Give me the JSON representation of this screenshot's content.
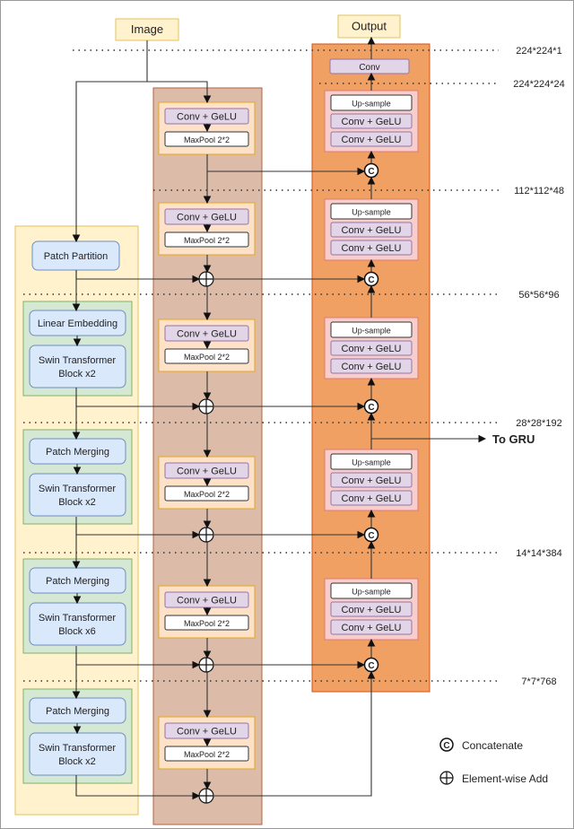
{
  "title_input": "Image",
  "title_output": "Output",
  "encoder": {
    "conv": "Conv + GeLU",
    "pool": "MaxPool 2*2"
  },
  "decoder": {
    "up": "Up-sample",
    "conv": "Conv + GeLU",
    "final_conv": "Conv"
  },
  "swin": {
    "partition": "Patch Partition",
    "embedding": "Linear Embedding",
    "merging": "Patch Merging",
    "blocks": [
      [
        "Swin Transformer",
        "Block x2"
      ],
      [
        "Swin Transformer",
        "Block x2"
      ],
      [
        "Swin Transformer",
        "Block x6"
      ],
      [
        "Swin Transformer",
        "Block x2"
      ]
    ]
  },
  "dims": [
    "224*224*1",
    "224*224*24",
    "112*112*48",
    "56*56*96",
    "28*28*192",
    "14*14*384",
    "7*7*768"
  ],
  "to_gru": "To GRU",
  "legend": {
    "concat_symbol": "C",
    "concat": "Concatenate",
    "add": "Element-wise Add"
  },
  "colors": {
    "encoder_column": "#dcbba8",
    "decoder_column": "#f0a062",
    "conv": "#e1d5e7",
    "swin_panel": "#fff2cc",
    "swin_group": "#d5e8d4",
    "swin_block": "#dae8fc"
  }
}
